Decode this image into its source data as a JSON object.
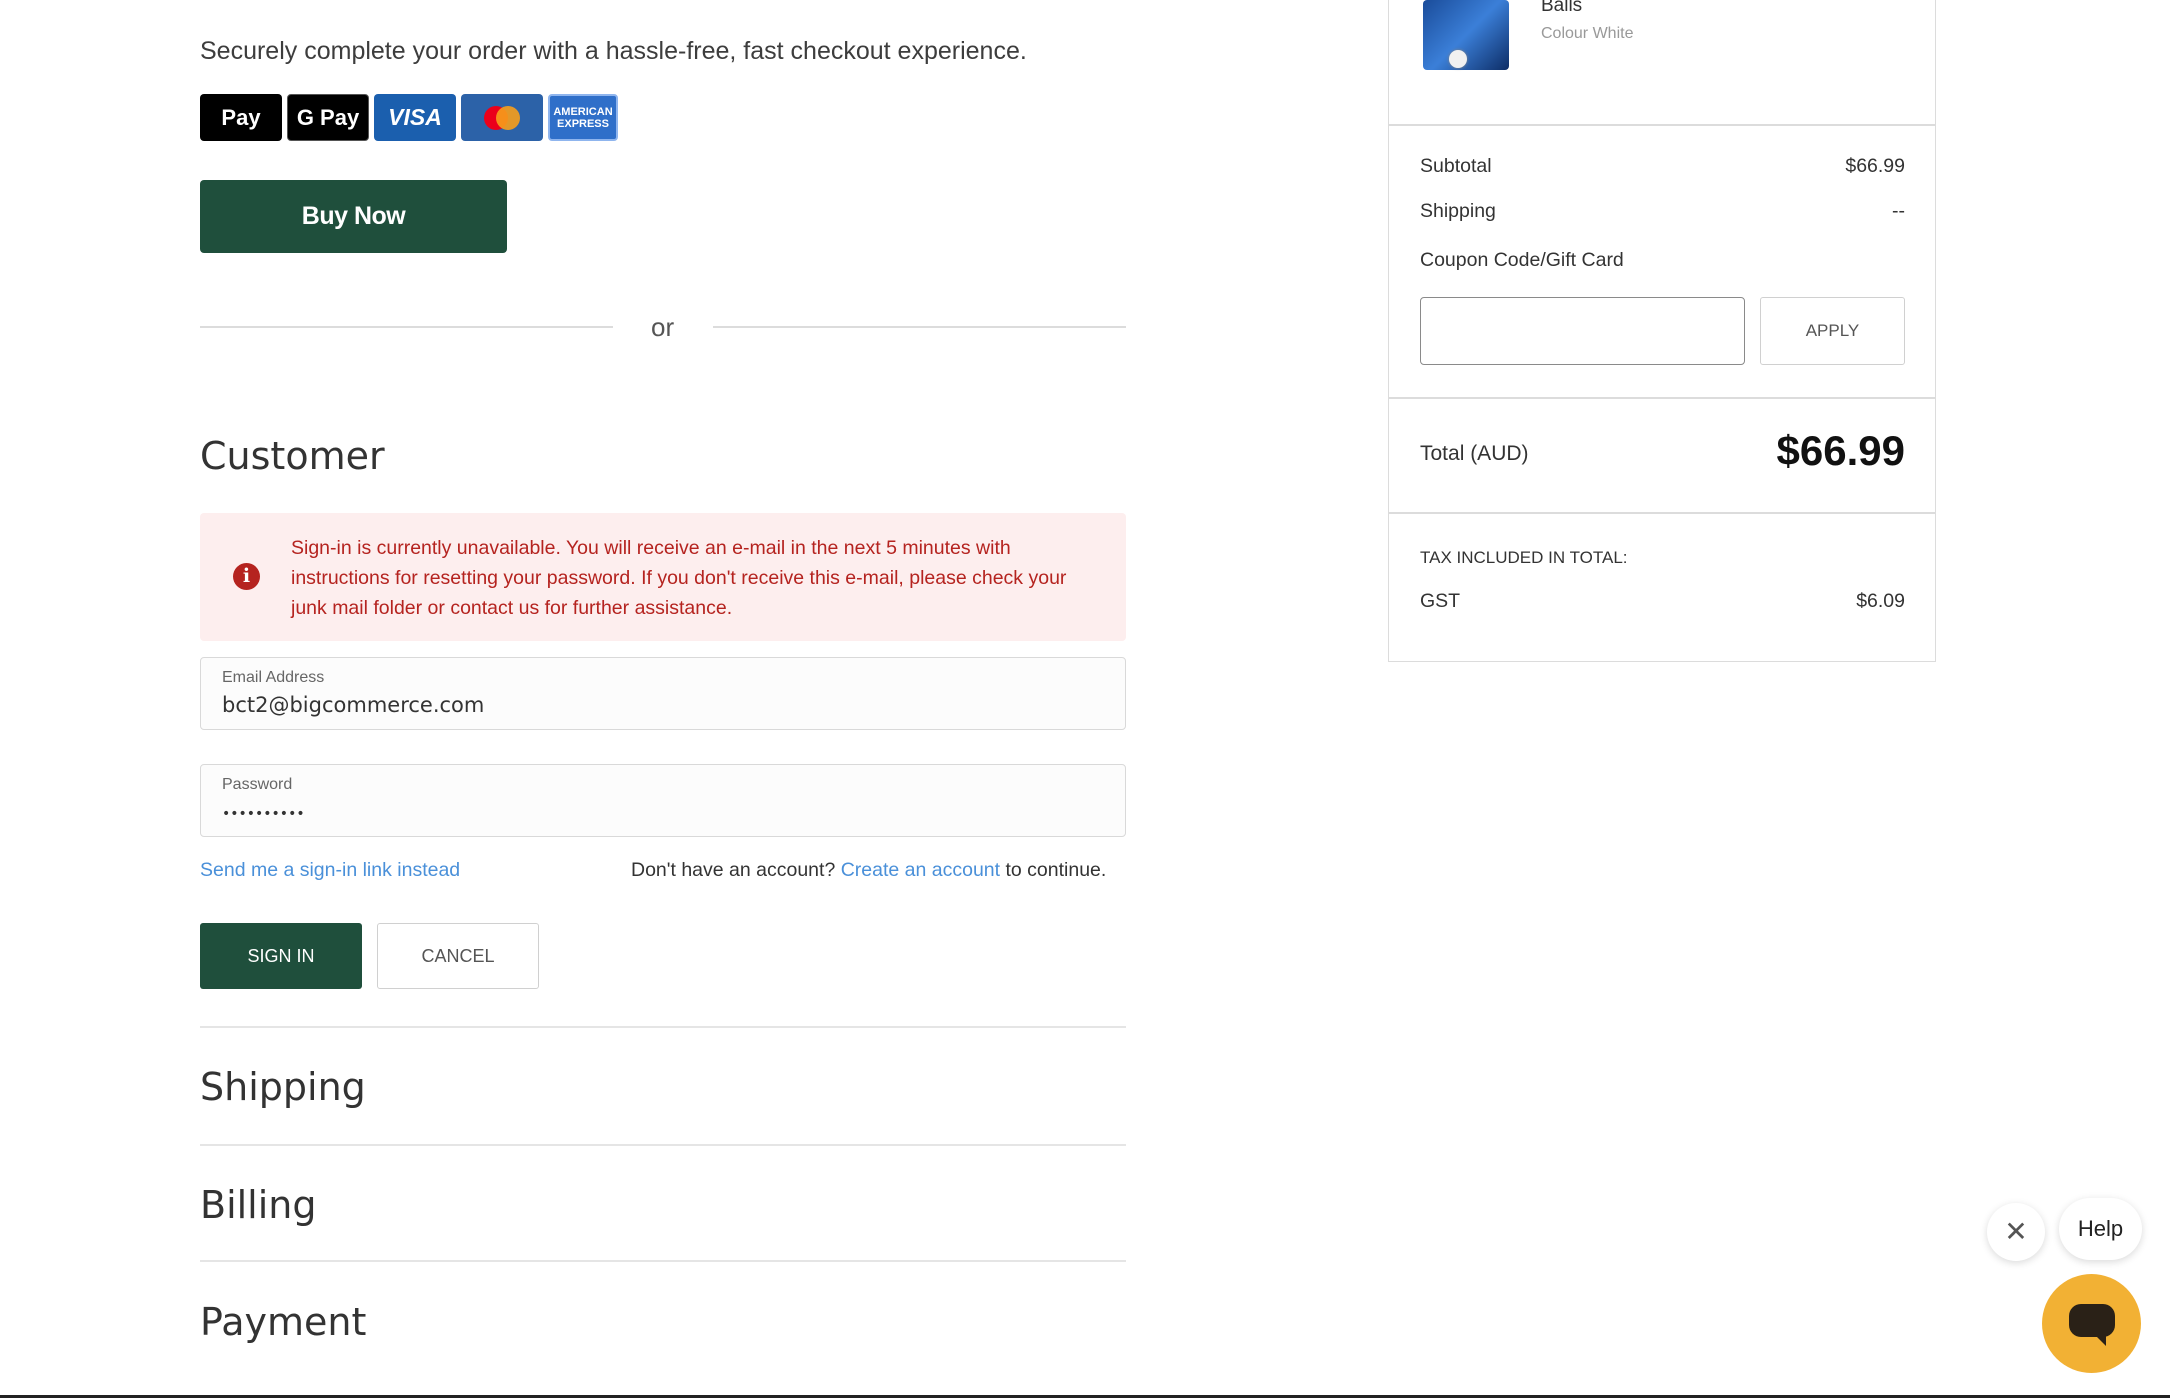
{
  "intro": "Securely complete your order with a hassle-free, fast checkout experience.",
  "payment_methods": {
    "apple_pay": " Pay",
    "google_pay": "G Pay",
    "visa": "VISA",
    "amex": "AMERICAN EXPRESS"
  },
  "buy_now_label": "Buy Now",
  "or_label": "or",
  "customer": {
    "title": "Customer",
    "alert": "Sign-in is currently unavailable. You will receive an e-mail in the next 5 minutes with instructions for resetting your password. If you don't receive this e-mail, please check your junk mail folder or contact us for further assistance.",
    "email_label": "Email Address",
    "email_value": "bct2@bigcommerce.com",
    "password_label": "Password",
    "password_value": "••••••••••",
    "signin_link": "Send me a sign-in link instead",
    "no_account": "Don't have an account?",
    "create_account": "Create an account",
    "to_continue": "to continue.",
    "signin_button": "SIGN IN",
    "cancel_button": "CANCEL"
  },
  "steps": {
    "shipping": "Shipping",
    "billing": "Billing",
    "payment": "Payment"
  },
  "summary": {
    "product_name": "Balls",
    "product_variant": "Colour White",
    "subtotal_label": "Subtotal",
    "subtotal_value": "$66.99",
    "shipping_label": "Shipping",
    "shipping_value": "--",
    "coupon_label": "Coupon Code/Gift Card",
    "apply_label": "APPLY",
    "total_label": "Total (AUD)",
    "total_value": "$66.99",
    "tax_label": "TAX INCLUDED IN TOTAL:",
    "gst_label": "GST",
    "gst_value": "$6.09"
  },
  "help": {
    "label": "Help"
  },
  "colors": {
    "brand_green": "#1f4f3c",
    "error_red": "#b5231f",
    "link_blue": "#4a90d9",
    "chat_orange": "#f2b134"
  }
}
